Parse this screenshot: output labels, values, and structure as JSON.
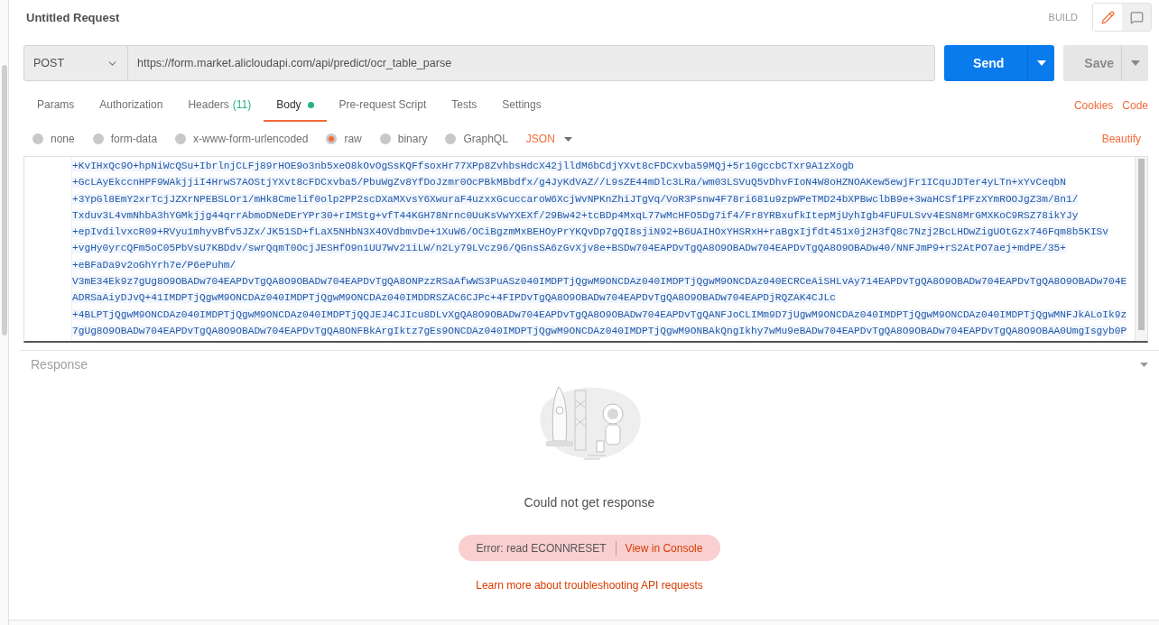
{
  "request": {
    "title": "Untitled Request",
    "mode": "BUILD"
  },
  "view_buttons": [
    {
      "kind": "edit",
      "selected": true
    },
    {
      "kind": "comments",
      "selected": false
    }
  ],
  "url_bar": {
    "method": "POST",
    "url": "https://form.market.alicloudapi.com/api/predict/ocr_table_parse",
    "send": "Send",
    "save": "Save"
  },
  "tabs": [
    {
      "label": "Params",
      "selected": false
    },
    {
      "label": "Authorization",
      "selected": false
    },
    {
      "label": "Headers",
      "count": "(11)",
      "selected": false
    },
    {
      "label": "Body",
      "selected": true,
      "dot": true
    },
    {
      "label": "Pre-request Script",
      "selected": false
    },
    {
      "label": "Tests",
      "selected": false
    },
    {
      "label": "Settings",
      "selected": false
    }
  ],
  "tab_links": [
    "Cookies",
    "Code"
  ],
  "body_types": [
    {
      "label": "none",
      "selected": false
    },
    {
      "label": "form-data",
      "selected": false
    },
    {
      "label": "x-www-form-urlencoded",
      "selected": false
    },
    {
      "label": "raw",
      "selected": true
    },
    {
      "label": "binary",
      "selected": false
    },
    {
      "label": "GraphQL",
      "selected": false
    }
  ],
  "format": "JSON",
  "beautify": "Beautify",
  "code_lines": [
    "+KvIHxQc9O+hpNiWcQSu+IbrlnjCLFj89rHOE9o3nb5xeO8kOvOgSsKQFfsoxHr77XPp8ZvhbsHdcX42jlldM6bCdjYXvt8cFDCxvba59MQj+5r10gccbCTxr9A1zXogb",
    "+GcLAyEkccnHPF9WAkjjiI4HrwS7AOStjYXvt8cFDCxvba5/PbuWgZv8YfDoJzmr0OcPBkMBbdfx/g4JyKdVAZ//L9sZE44mDlc3LRa/wm03LSVuQ5vDhvFIoN4W8oHZNOAKew5ewjFr1ICquJDTer4yLTn+xYvCeqbN",
    "+3YpGl8EmY2xrTcjJZXrNPEBSLOr1/mHk8Cmelif0olp2PP2scDXaMXvsY6XwuraF4uzxxGcuccaroW6XcjWvNPKnZhiJTgVq/VoR3Psnw4F78ri681u9zpWPeTMD24bXPBwclbB9e+3waHCSf1PFzXYmROOJgZ3m/8n1/",
    "Txduv3L4vmNhbA3hYGMkjjg44qrrAbmoDNeDErYPr30+rIMStg+vfT44KGH78Nrnc0UuKsVwYXEXf/29Bw42+tcBDp4MxqL77wMcHFO5Dg7if4/Fr8YRBxufkItepMjUyhIgb4FUFULSvv4ESN8MrGMXKoC9RSZ78ikYJy",
    "+epIvdilvxcR09+RVyu1mhyvBfv5JZx/JK51SD+fLaX5NHbN3X4OVdbmvDe+1XuW6/OCiBgzmMxBEHOyPrYKQvDp7gQI8sjiN92+B6UAIHOxYHSRxH+raBgxIjfdt451x0j2H3fQ8c7Nzj2BcLHDwZigUOtGzx746Fqm8b5KISv",
    "+vgHy0yrcQFm5oC05PbVsU7KBDdv/swrQqmT0OcjJESHfO9n1UU7Wv21iLW/n2Ly79LVcz96/QGnsSA6zGvXjv8e+BSDw704EAPDvTgQA8O9OBADw704EAPDvTgQA8O9OBADw40/NNFJmP9+rS2AtPO7aej+mdPE/35+",
    "+eBFaDa9v2oGhYrh7e/P6ePuhm/",
    "V3mE34Ek9z7gUg8O9OBADw704EAPDvTgQA8O9OBADw704EAPDvTgQA8ONPzzRSaAfwWS3PuASz040IMDPTjQgwM9ONCDAz040IMDPTjQgwM9ONCDAz040ECRCeAiSHLvAy714EAPDvTgQA8O9OBADw704EAPDvTgQA8O9OBADw704E",
    "ADRSaAiyDJvQ+41IMDPTjQgwM9ONCDAz040IMDPTjQgwM9ONCDAz040IMDDRSZAC6CJPc+4FIPDvTgQA8O9OBADw704EAPDvTgQA8O9OBADw704EAPDjRQZAK4CJLc",
    "+4BLPTjQgwM9ONCDAz040IMDPTjQgwM9ONCDAz040IMDPTjQQJEJ4CJIcu8DLvXgQA8O9OBADw704EAPDvTgQA8O9OBADw704EAPDvTgQANFJoCLIMm9D7jUgwM9ONCDAz040IMDPTjQgwM9ONCDAz040IMDPTjQgwMNFJkALoIk9z",
    "7gUg8O9OBADw704EAPDvTgQA8O9OBADw704EAPDvTgQA8ONFBkArgIktz7gEs9ONCDAz040IMDPTjQgwM9ONCDAz040IMDPTjQgwM9ONBAkQngIkhy7wMu9eBADw704EAPDvTgQA8O9OBADw704EAPDvTgQA8O9OBAA0UmgIsgyb0P"
  ],
  "response": {
    "title": "Response",
    "message": "Could not get response",
    "error": "Error: read ECONNRESET",
    "console_link": "View in Console",
    "help_link": "Learn more about troubleshooting API requests"
  }
}
